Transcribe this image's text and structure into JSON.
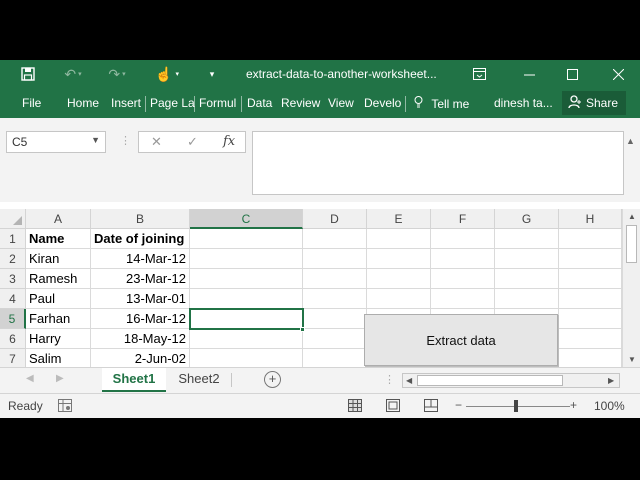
{
  "window": {
    "title": "extract-data-to-another-worksheet..."
  },
  "colors": {
    "accent": "#217346",
    "selection_border": "#217346"
  },
  "ribbon": {
    "tabs": [
      "File",
      "Home",
      "Insert",
      "Page La",
      "Formul",
      "Data",
      "Review",
      "View",
      "Develo"
    ],
    "tell_me": "Tell me",
    "user": "dinesh ta...",
    "share": "Share"
  },
  "formula_bar": {
    "name_box": "C5",
    "cancel_symbol": "✕",
    "enter_symbol": "✓",
    "fx_symbol": "fx",
    "formula_value": ""
  },
  "grid": {
    "columns": [
      "A",
      "B",
      "C",
      "D",
      "E",
      "F",
      "G",
      "H"
    ],
    "selected_column": "C",
    "row_numbers": [
      "1",
      "2",
      "3",
      "4",
      "5",
      "6",
      "7"
    ],
    "selected_row": "5",
    "rows": [
      {
        "A": "Name",
        "B": "Date of joining"
      },
      {
        "A": "Kiran",
        "B": "14-Mar-12"
      },
      {
        "A": "Ramesh",
        "B": "23-Mar-12"
      },
      {
        "A": "Paul",
        "B": "13-Mar-01"
      },
      {
        "A": "Farhan",
        "B": "16-Mar-12"
      },
      {
        "A": "Harry",
        "B": "18-May-12"
      },
      {
        "A": "Salim",
        "B": "2-Jun-02"
      }
    ]
  },
  "extract_button": {
    "label": "Extract data"
  },
  "sheets": {
    "tabs": [
      "Sheet1",
      "Sheet2"
    ],
    "active": "Sheet1"
  },
  "status": {
    "text": "Ready",
    "zoom": "100%",
    "zoom_minus": "−",
    "zoom_plus": "+"
  }
}
